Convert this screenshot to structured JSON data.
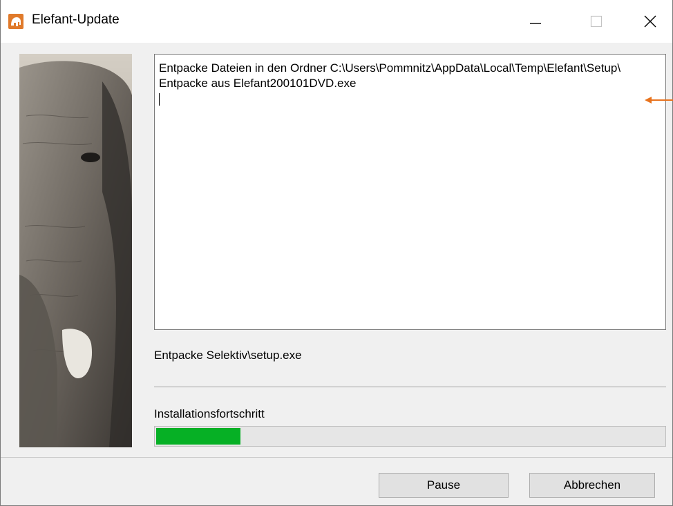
{
  "window": {
    "title": "Elefant-Update",
    "icon": "elephant-app-icon"
  },
  "titlebar_buttons": {
    "minimize": "minimize-icon",
    "maximize": "maximize-icon",
    "close": "close-icon"
  },
  "log": {
    "lines": [
      "Entpacke Dateien in den Ordner C:\\Users\\Pommnitz\\AppData\\Local\\Temp\\Elefant\\Setup\\",
      "Entpacke aus Elefant200101DVD.exe"
    ]
  },
  "status": {
    "current_action": "Entpacke Selektiv\\setup.exe"
  },
  "progress": {
    "label": "Installationsfortschritt",
    "fraction": 0.17,
    "color": "#06b025"
  },
  "buttons": {
    "pause": "Pause",
    "cancel": "Abbrechen"
  },
  "colors": {
    "accent_arrow": "#e8731e"
  }
}
